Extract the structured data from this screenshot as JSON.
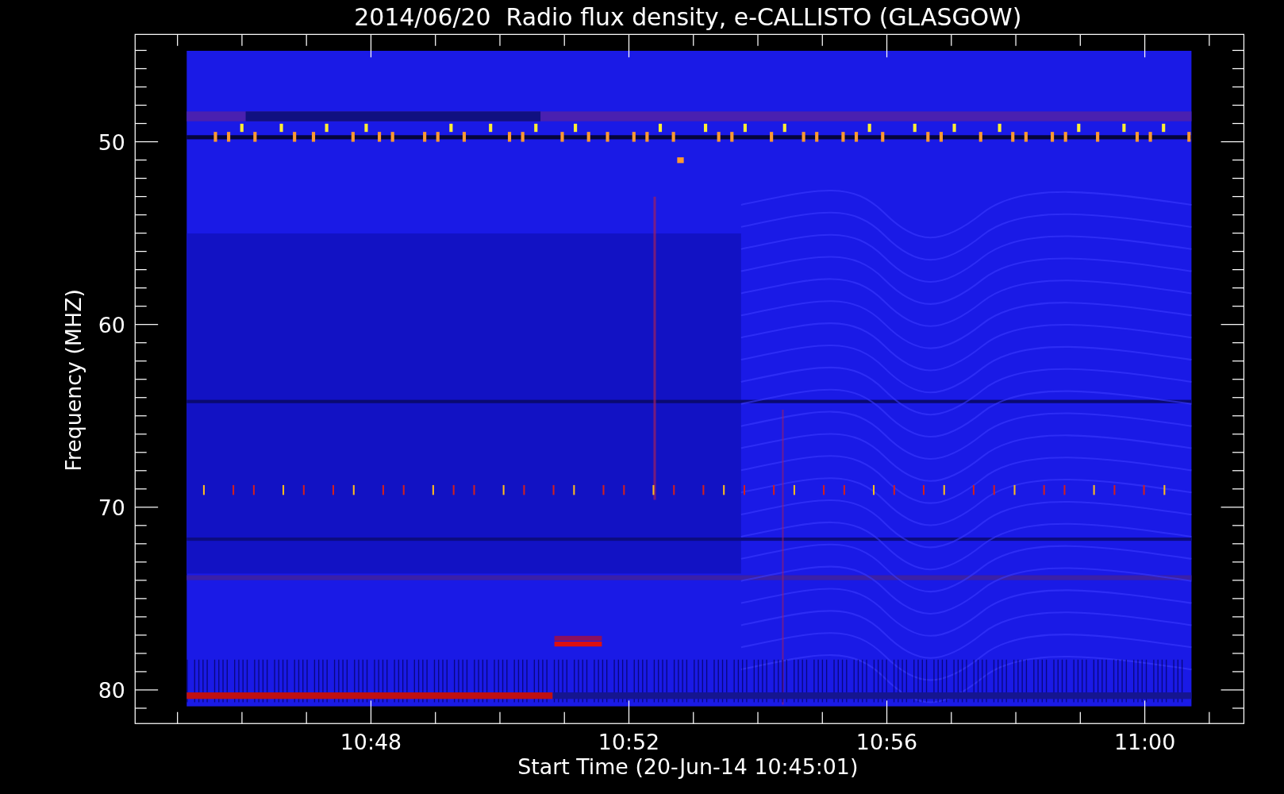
{
  "title": "2014/06/20  Radio flux density, e-CALLISTO (GLASGOW)",
  "chart": {
    "xlabel": "Start Time (20-Jun-14 10:45:01)",
    "ylabel": "Frequency (MHZ)",
    "xticks": [
      "10:48",
      "10:52",
      "10:56",
      "11:00"
    ],
    "yticks": [
      "50",
      "60",
      "70",
      "80"
    ]
  }
}
